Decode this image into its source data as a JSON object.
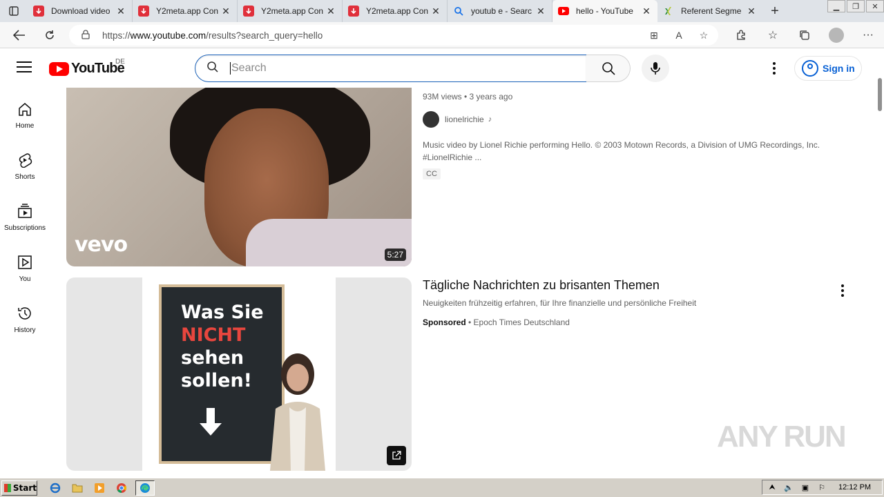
{
  "browser": {
    "tabs": [
      {
        "title": "Download video",
        "favicon_color": "#e0303b",
        "active": false
      },
      {
        "title": "Y2meta.app Con",
        "favicon_color": "#e0303b",
        "active": false
      },
      {
        "title": "Y2meta.app Con",
        "favicon_color": "#e0303b",
        "active": false
      },
      {
        "title": "Y2meta.app Con",
        "favicon_color": "#e0303b",
        "active": false
      },
      {
        "title": "youtub e - Searc",
        "favicon_color": "#1a73e8",
        "active": false
      },
      {
        "title": "hello - YouTube",
        "favicon_color": "#ff0000",
        "active": true
      },
      {
        "title": "Referent Segme",
        "favicon_color": "#2a8d3a",
        "active": false
      }
    ],
    "url_prefix": "https://",
    "url_domain": "www.youtube.com",
    "url_path": "/results?search_query=hello"
  },
  "youtube": {
    "logo_text": "YouTube",
    "country_code": "DE",
    "search_placeholder": "Search",
    "sign_in_label": "Sign in",
    "guide": [
      {
        "label": "Home",
        "icon": "home-icon"
      },
      {
        "label": "Shorts",
        "icon": "shorts-icon"
      },
      {
        "label": "Subscriptions",
        "icon": "subscriptions-icon"
      },
      {
        "label": "You",
        "icon": "you-icon"
      },
      {
        "label": "History",
        "icon": "history-icon"
      }
    ],
    "results": [
      {
        "stats": "93M views • 3 years ago",
        "channel": "lionelrichie",
        "description": "Music video by Lionel Richie performing Hello. © 2003 Motown Records, a Division of UMG Recordings, Inc. #LionelRichie ...",
        "badge": "CC",
        "duration": "5:27",
        "thumb_brand": "vevo"
      },
      {
        "title": "Tägliche Nachrichten zu brisanten Themen",
        "subtitle": "Neuigkeiten frühzeitig erfahren, für Ihre finanzielle und persönliche Freiheit",
        "sponsored_label": "Sponsored",
        "advertiser": "Epoch Times Deutschland",
        "thumb_line1": "Was Sie",
        "thumb_line2": "NICHT",
        "thumb_line3": "sehen",
        "thumb_line4": "sollen!"
      }
    ]
  },
  "watermark": "ANY RUN",
  "taskbar": {
    "start_label": "Start",
    "clock": "12:12 PM"
  }
}
